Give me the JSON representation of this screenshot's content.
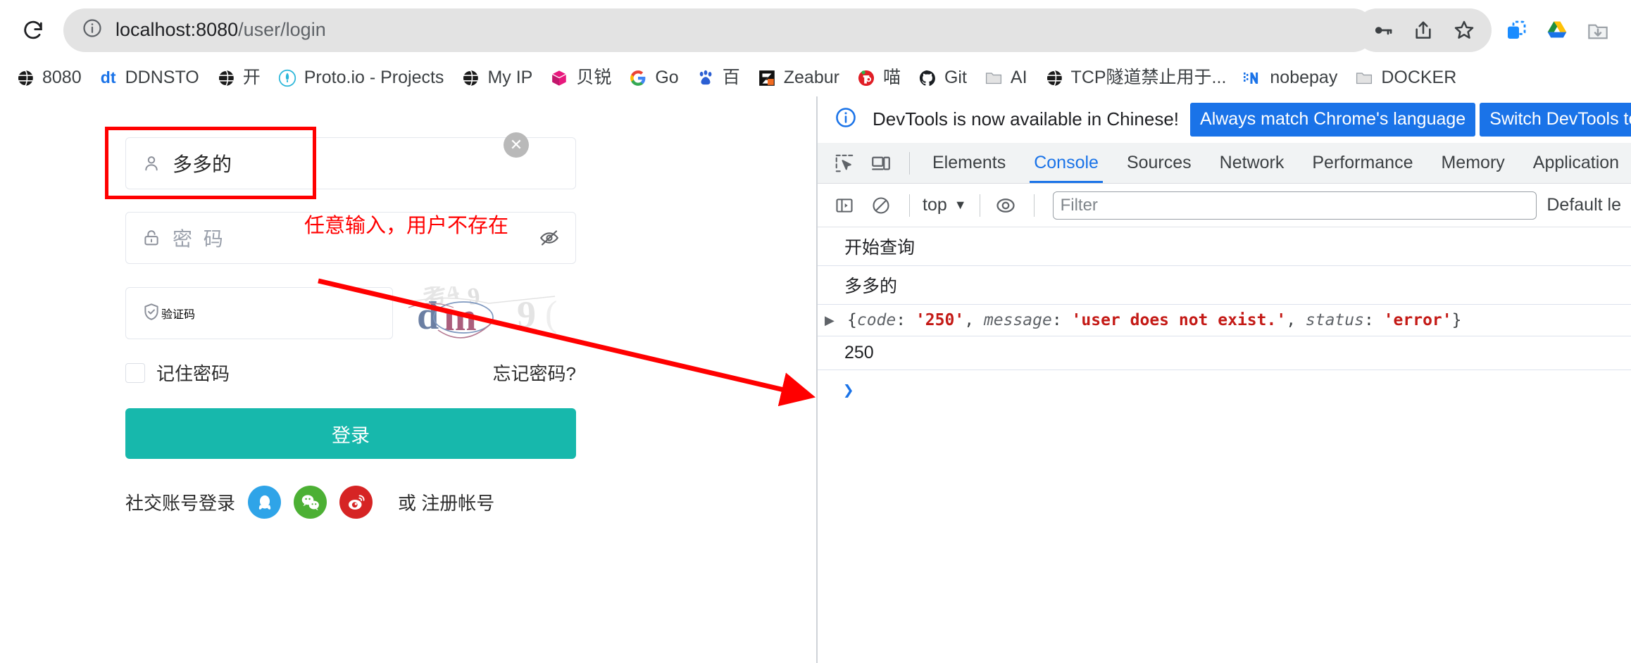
{
  "browser": {
    "reload_icon": "reload-icon",
    "url_display": {
      "host": "localhost:8080",
      "path": "/user/login"
    },
    "site_info_icon": "site-info-icon",
    "omnibox_actions": [
      {
        "name": "password-key-icon",
        "icon": "key-icon"
      },
      {
        "name": "share-icon",
        "icon": "share-icon"
      },
      {
        "name": "bookmark-star-icon",
        "icon": "star-icon"
      }
    ],
    "extension_actions": [
      {
        "name": "extension-copy-icon",
        "icon": "copy-icon"
      },
      {
        "name": "google-drive-icon",
        "icon": "drive-icon"
      },
      {
        "name": "download-folder-icon",
        "icon": "folder-download-icon"
      }
    ]
  },
  "bookmarks": [
    {
      "label": "8080",
      "icon": "globe-icon"
    },
    {
      "label": "DDNSTO",
      "icon": "ddnsto-icon"
    },
    {
      "label": "开",
      "icon": "globe-icon"
    },
    {
      "label": "Proto.io - Projects",
      "icon": "proto-rocket-icon"
    },
    {
      "label": "My IP",
      "icon": "globe-icon"
    },
    {
      "label": "贝锐",
      "icon": "beirui-cube-icon"
    },
    {
      "label": "Go",
      "icon": "google-g-icon"
    },
    {
      "label": "百",
      "icon": "baidu-paw-icon"
    },
    {
      "label": "Zeabur",
      "icon": "zeabur-icon"
    },
    {
      "label": "喵",
      "icon": "miao-icon"
    },
    {
      "label": "Git",
      "icon": "github-icon"
    },
    {
      "label": "AI",
      "icon": "folder-icon"
    },
    {
      "label": "TCP隧道禁止用于...",
      "icon": "globe-icon"
    },
    {
      "label": "nobepay",
      "icon": "nobepay-icon"
    },
    {
      "label": "DOCKER",
      "icon": "folder-icon"
    }
  ],
  "login": {
    "username": {
      "value": "多多的",
      "icon": "user-icon"
    },
    "password": {
      "placeholder": "密 码",
      "icon": "lock-icon",
      "toggle_icon": "eye-off-icon"
    },
    "captcha": {
      "placeholder": "验证码",
      "icon": "shield-check-icon",
      "image_text": "dm9"
    },
    "remember_label": "记住密码",
    "forgot_label": "忘记密码?",
    "submit_label": "登录",
    "submit_color": "#17b8ac",
    "social_label": "社交账号登录",
    "social_icons": [
      {
        "name": "qq-icon",
        "color": "#2fa4e8"
      },
      {
        "name": "wechat-icon",
        "color": "#4cb034"
      },
      {
        "name": "weibo-icon",
        "color": "#d62424"
      }
    ],
    "register_text": "或 注册帐号",
    "clear_icon": "clear-x-icon"
  },
  "annotation": {
    "text": "任意输入，用户不存在",
    "color": "#ff0000",
    "highlight_color": "#ff0000"
  },
  "devtools": {
    "banner": {
      "icon": "info-icon",
      "message": "DevTools is now available in Chinese!",
      "buttons": [
        "Always match Chrome's language",
        "Switch DevTools to Chine"
      ]
    },
    "toolbar_icons": [
      {
        "name": "inspect-element-icon"
      },
      {
        "name": "device-toolbar-icon"
      }
    ],
    "tabs": [
      {
        "label": "Elements",
        "active": false
      },
      {
        "label": "Console",
        "active": true
      },
      {
        "label": "Sources",
        "active": false
      },
      {
        "label": "Network",
        "active": false
      },
      {
        "label": "Performance",
        "active": false
      },
      {
        "label": "Memory",
        "active": false
      },
      {
        "label": "Application",
        "active": false
      }
    ],
    "console_toolbar": {
      "sidebar_icon": "console-sidebar-icon",
      "clear_icon": "clear-console-icon",
      "context": "top",
      "chevron_icon": "chevron-down-icon",
      "eye_icon": "live-expression-eye-icon",
      "filter_value": "",
      "filter_placeholder": "Filter",
      "level_label": "Default le"
    },
    "console_rows": [
      {
        "type": "text",
        "text": "开始查询"
      },
      {
        "type": "text",
        "text": "多多的"
      },
      {
        "type": "object",
        "arrow": "▶",
        "tokens": [
          {
            "t": "pun",
            "v": "{"
          },
          {
            "t": "key",
            "v": "code"
          },
          {
            "t": "pun",
            "v": ": "
          },
          {
            "t": "str",
            "v": "'250'"
          },
          {
            "t": "pun",
            "v": ", "
          },
          {
            "t": "key",
            "v": "message"
          },
          {
            "t": "pun",
            "v": ": "
          },
          {
            "t": "str",
            "v": "'user does not exist.'"
          },
          {
            "t": "pun",
            "v": ", "
          },
          {
            "t": "key",
            "v": "status"
          },
          {
            "t": "pun",
            "v": ": "
          },
          {
            "t": "str",
            "v": "'error'"
          },
          {
            "t": "pun",
            "v": "}"
          }
        ]
      },
      {
        "type": "text",
        "text": "250"
      }
    ],
    "prompt_symbol": "❯"
  }
}
